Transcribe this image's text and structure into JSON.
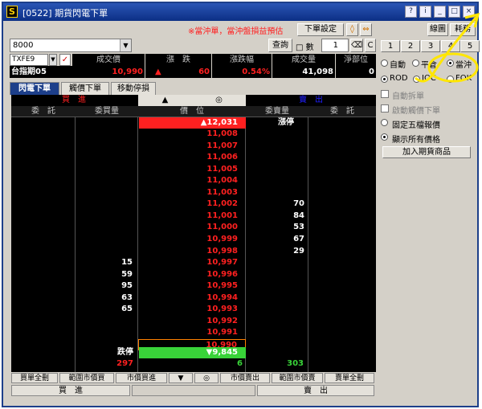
{
  "window": {
    "title": "[0522] 期貨閃電下單",
    "icon_letter": "S",
    "notice": "※當沖單，當沖盤損益預估"
  },
  "toolbar": {
    "order_settings_label": "下單設定",
    "query_label": "查詢",
    "qty_label": "□ 數",
    "qty_value": "1",
    "c_label": "C",
    "line_label": "線圖",
    "tick_label": "耗務"
  },
  "account": {
    "value": "8000"
  },
  "symbol": {
    "code": "TXFE9",
    "name": "台指期05"
  },
  "quote_headers": [
    "成交價",
    "漲　跌",
    "漲跌幅",
    "成交量",
    "淨部位"
  ],
  "quote_values": {
    "last": "10,990",
    "change_arrow": "▲",
    "change": "60",
    "change_pct": "0.54%",
    "volume": "41,098",
    "net_position": "0"
  },
  "tabs": [
    "閃電下單",
    "觸價下單",
    "移動停損"
  ],
  "grid": {
    "buy_label": "買　進",
    "sell_label": "賣　出",
    "up_arrow": "▲",
    "center_icon": "◎",
    "headers": [
      "委　託",
      "委買量",
      "價　位",
      "委賣量",
      "委　託"
    ],
    "limit_up_label": "漲停",
    "limit_down_label": "跌停",
    "limit_up_price": "▲12,031",
    "limit_down_price": "▼9,845",
    "rows": [
      {
        "price": "11,008",
        "bid": "",
        "ask": ""
      },
      {
        "price": "11,007",
        "bid": "",
        "ask": ""
      },
      {
        "price": "11,006",
        "bid": "",
        "ask": ""
      },
      {
        "price": "11,005",
        "bid": "",
        "ask": ""
      },
      {
        "price": "11,004",
        "bid": "",
        "ask": ""
      },
      {
        "price": "11,003",
        "bid": "",
        "ask": ""
      },
      {
        "price": "11,002",
        "bid": "",
        "ask": "70"
      },
      {
        "price": "11,001",
        "bid": "",
        "ask": "84"
      },
      {
        "price": "11,000",
        "bid": "",
        "ask": "53"
      },
      {
        "price": "10,999",
        "bid": "",
        "ask": "67"
      },
      {
        "price": "10,998",
        "bid": "",
        "ask": "29"
      },
      {
        "price": "10,997",
        "bid": "15",
        "ask": ""
      },
      {
        "price": "10,996",
        "bid": "59",
        "ask": ""
      },
      {
        "price": "10,995",
        "bid": "95",
        "ask": ""
      },
      {
        "price": "10,994",
        "bid": "63",
        "ask": ""
      },
      {
        "price": "10,993",
        "bid": "65",
        "ask": ""
      },
      {
        "price": "10,992",
        "bid": "",
        "ask": ""
      },
      {
        "price": "10,991",
        "bid": "",
        "ask": ""
      },
      {
        "price": "10,990",
        "bid": "",
        "ask": ""
      }
    ],
    "total_bid": "297",
    "total_mid": "6",
    "total_ask": "303"
  },
  "bottom_buttons": [
    "買單全刪",
    "範圍市價買",
    "市價買進",
    "▼",
    "◎",
    "市價賣出",
    "範圍市價賣",
    "賣單全刪"
  ],
  "action_buttons": {
    "buy": "買　進",
    "sell": "賣　出"
  },
  "side": {
    "num_buttons": [
      "1",
      "2",
      "3",
      "4",
      "5"
    ],
    "radio_row1": [
      "自動",
      "平倉",
      "當沖"
    ],
    "radio_row2": [
      "ROD",
      "IOC",
      "FOK"
    ],
    "auto_split": "自動拆單",
    "trigger_order": "啟動觸價下單",
    "fixed_five": "固定五檔報價",
    "show_all": "顯示所有價格",
    "add_futures": "加入期貨商品"
  },
  "colors": {
    "accent_red": "#ff2020",
    "green": "#39d339",
    "blue": "#2020ff",
    "highlight": "#ffe600"
  }
}
